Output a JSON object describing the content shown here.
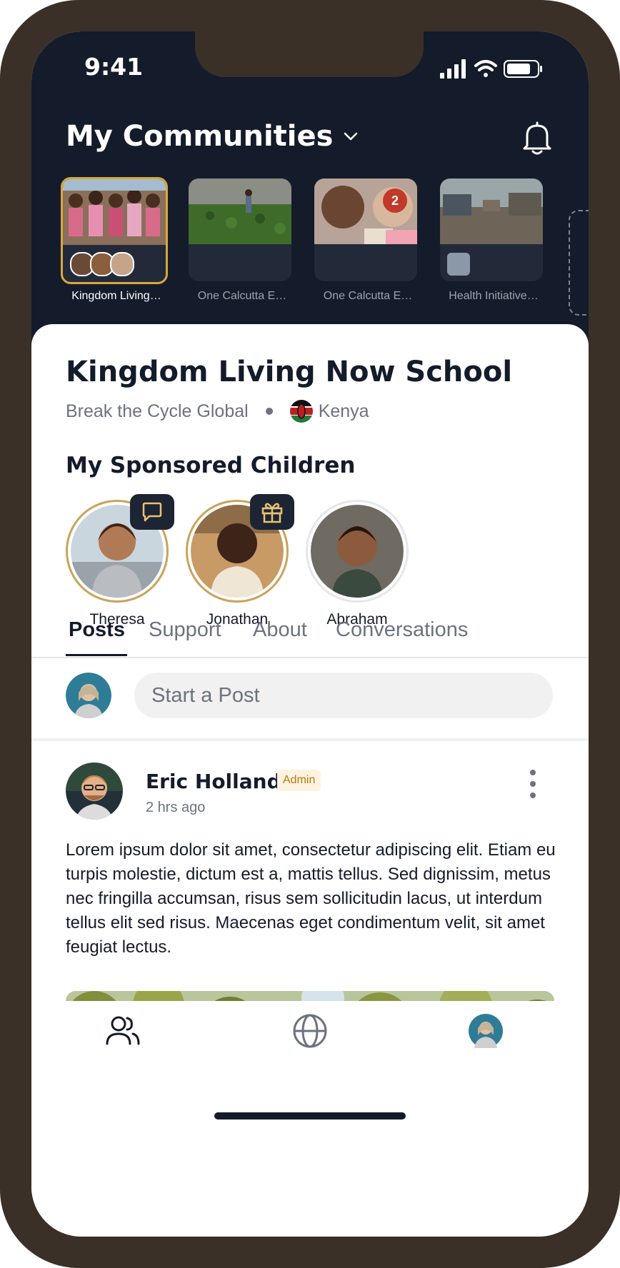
{
  "status_bar": {
    "time": "9:41"
  },
  "header": {
    "title": "My Communities"
  },
  "communities": [
    {
      "label": "Kingdom Living…",
      "selected": true
    },
    {
      "label": "One Calcutta E…",
      "selected": false
    },
    {
      "label": "One Calcutta E…",
      "selected": false,
      "badge": "2"
    },
    {
      "label": "Health Initiative…",
      "selected": false
    }
  ],
  "community": {
    "title": "Kingdom Living Now School",
    "organization": "Break the Cycle Global",
    "country": "Kenya"
  },
  "sponsored": {
    "title": "My Sponsored Children",
    "children": [
      {
        "name": "Theresa",
        "tag_icon": "message-icon"
      },
      {
        "name": "Jonathan",
        "tag_icon": "gift-icon"
      },
      {
        "name": "Abraham"
      }
    ]
  },
  "tabs": [
    "Posts",
    "Support",
    "About",
    "Conversations"
  ],
  "active_tab": "Posts",
  "composer": {
    "placeholder": "Start a Post"
  },
  "post": {
    "author": "Eric Holland",
    "badge": "Admin",
    "time": "2 hrs ago",
    "body": "Lorem ipsum dolor sit amet, consectetur adipiscing elit. Etiam eu turpis molestie, dictum est a, mattis tellus. Sed dignissim, metus nec fringilla accumsan, risus sem sollicitudin lacus, ut interdum tellus elit sed risus. Maecenas eget condimentum velit, sit amet feugiat lectus."
  },
  "bottom_nav": [
    "communities-icon",
    "globe-icon",
    "profile-avatar"
  ],
  "colors": {
    "dark": "#141b2a",
    "accent": "#d9a73b",
    "badge_red": "#c0392b"
  }
}
